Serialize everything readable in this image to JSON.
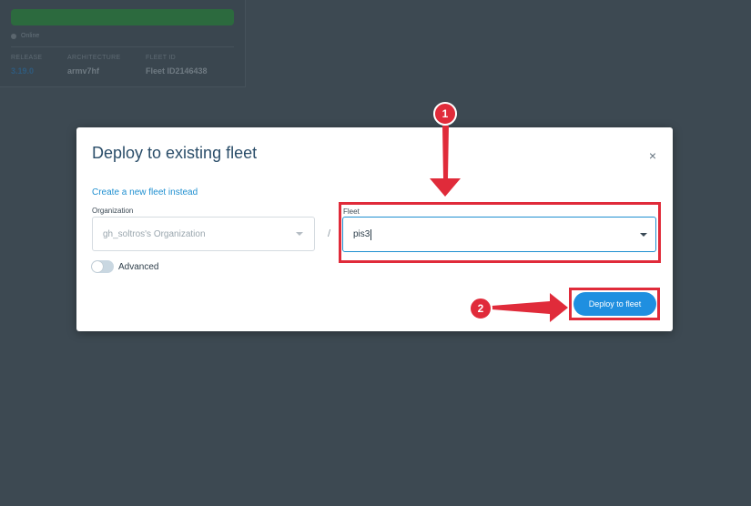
{
  "background": {
    "status": "Online",
    "columns": [
      {
        "label": "RELEASE",
        "value": "3.19.0"
      },
      {
        "label": "ARCHITECTURE",
        "value": "armv7hf"
      },
      {
        "label": "FLEET ID",
        "value": "Fleet ID2146438"
      }
    ]
  },
  "modal": {
    "title": "Deploy to existing fleet",
    "close_icon": "×",
    "create_link": "Create a new fleet instead",
    "organization": {
      "label": "Organization",
      "value": "gh_soltros's Organization"
    },
    "separator": "/",
    "fleet": {
      "label": "Fleet",
      "value": "pis3"
    },
    "advanced_label": "Advanced",
    "deploy_button": "Deploy to fleet"
  },
  "annotations": {
    "step1": "1",
    "step2": "2",
    "color": "#e02b3a"
  },
  "colors": {
    "accent": "#1f8fe0",
    "backdrop": "#3d4952",
    "progress": "#2c6a3e"
  }
}
